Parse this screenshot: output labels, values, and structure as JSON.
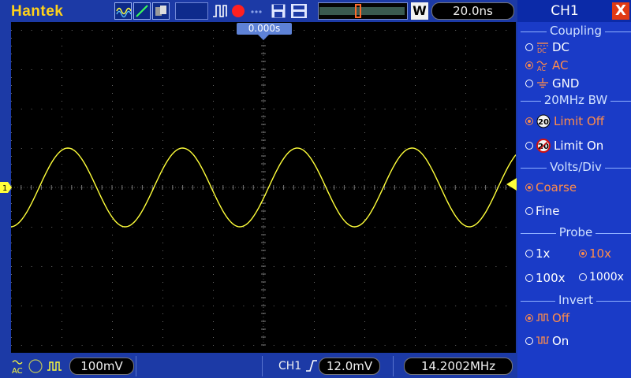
{
  "brand": "Hantek",
  "toolbar": {
    "timebase": "20.0ns",
    "window_label": "W",
    "icons": [
      "waveform-icon",
      "line-icon",
      "persistence-icon",
      "pulse-icon",
      "record-icon",
      "dots-icon",
      "save-icon",
      "print-icon"
    ],
    "record_color": "#ff2020"
  },
  "screen": {
    "trigger_time": "0.000s",
    "channel_marker": "1",
    "trace_color": "#ffff3a",
    "signal": {
      "cycles_visible": 4.4,
      "amplitude_divs": 1.0
    }
  },
  "bottom": {
    "coupling_symbol": "AC",
    "volts_div": "100mV",
    "trigger_channel": "CH1",
    "trigger_level": "12.0mV",
    "frequency": "14.2002MHz"
  },
  "panel": {
    "title": "CH1",
    "close": "X",
    "coupling": {
      "title": "Coupling",
      "options": [
        "DC",
        "AC",
        "GND"
      ],
      "selected": 1
    },
    "bw": {
      "title": "20MHz BW",
      "options": [
        "Limit Off",
        "Limit On"
      ],
      "selected": 0
    },
    "volts": {
      "title": "Volts/Div",
      "options": [
        "Coarse",
        "Fine"
      ],
      "selected": 0
    },
    "probe": {
      "title": "Probe",
      "options": [
        "1x",
        "10x",
        "100x",
        "1000x"
      ],
      "selected": 1
    },
    "invert": {
      "title": "Invert",
      "options": [
        "Off",
        "On"
      ],
      "selected": 0
    }
  }
}
